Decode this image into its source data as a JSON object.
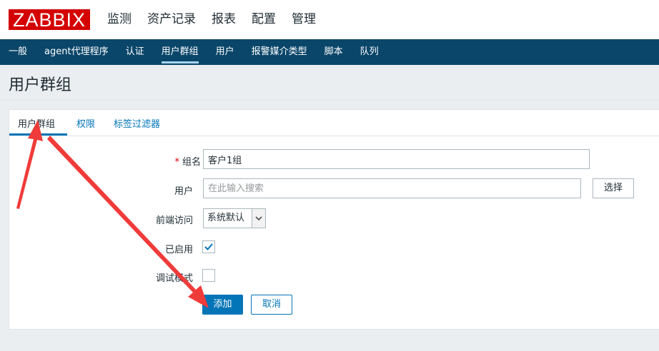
{
  "brand": {
    "logo_text": "ZABBIX",
    "logo_color": "#d40000"
  },
  "main_nav": {
    "items": [
      "监测",
      "资产记录",
      "报表",
      "配置",
      "管理"
    ],
    "active": "管理"
  },
  "sub_nav": {
    "items": [
      "一般",
      "agent代理程序",
      "认证",
      "用户群组",
      "用户",
      "报警媒介类型",
      "脚本",
      "队列"
    ],
    "active": "用户群组"
  },
  "page": {
    "title": "用户群组"
  },
  "tabs": {
    "items": [
      "用户群组",
      "权限",
      "标签过滤器"
    ],
    "active": "用户群组"
  },
  "form": {
    "group_name": {
      "label": "组名",
      "required": true,
      "value": "客户1组"
    },
    "users": {
      "label": "用户",
      "placeholder": "在此输入搜索",
      "select_button": "选择"
    },
    "frontend_access": {
      "label": "前端访问",
      "selected": "系统默认"
    },
    "enabled": {
      "label": "已启用",
      "checked": true
    },
    "debug_mode": {
      "label": "调试模式",
      "checked": false
    },
    "add_button": "添加",
    "cancel_button": "取消"
  },
  "annotation": {
    "arrow_color": "#ef3b39",
    "icon": "red-arrow-icon"
  },
  "colors": {
    "nav_dark": "#0a466a",
    "accent": "#0275b8"
  }
}
